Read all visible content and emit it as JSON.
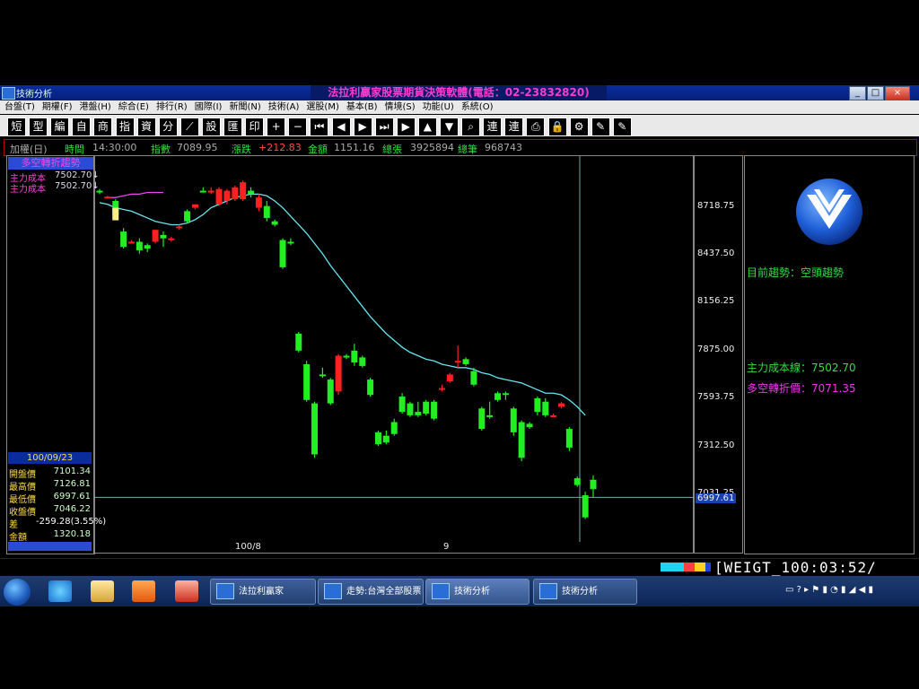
{
  "window": {
    "title": "技術分析",
    "app_title": "法拉利贏家股票期貨決策軟體(電話：02-23832820)",
    "controls": [
      "_",
      "□",
      "×"
    ]
  },
  "menu": [
    "台盤(T)",
    "期權(F)",
    "港盤(H)",
    "綜合(E)",
    "排行(R)",
    "國際(I)",
    "新聞(N)",
    "技術(A)",
    "選股(M)",
    "基本(B)",
    "情境(S)",
    "功能(U)",
    "系統(O)"
  ],
  "toolbar": [
    "短",
    "型",
    "編",
    "自",
    "商",
    "指",
    "資",
    "分",
    "⟋",
    "設",
    "匯",
    "印",
    "+",
    "−",
    "⏮",
    "◀",
    "▶",
    "⏭",
    "▶",
    "▲",
    "▼",
    "⌕",
    "連",
    "連",
    "⎙",
    "🔒",
    "⚙",
    "✎",
    "✎"
  ],
  "infobar": {
    "symbol": "加權(日)",
    "time_label": "時間",
    "time_value": "14:30:00",
    "index_label": "指數",
    "index_value": "7089.95",
    "change_label": "漲跌",
    "change_value": "+212.83",
    "amount_label": "金額",
    "amount_value": "1151.16",
    "vol_label": "總張",
    "vol_value": "3925894",
    "trades_label": "總筆",
    "trades_value": "968743"
  },
  "indicator": {
    "title": "多空轉折趨勢",
    "line1": "主力成本",
    "line1_value": "7502.70↓",
    "line2": "主力成本",
    "line2_value": "7502.70↓"
  },
  "ohlc": {
    "date": "100/09/23",
    "rows": [
      {
        "label": "開盤價",
        "value": "7101.34"
      },
      {
        "label": "最高價",
        "value": "7126.81"
      },
      {
        "label": "最低價",
        "value": "6997.61"
      },
      {
        "label": "收盤價",
        "value": "7046.22"
      },
      {
        "label": "差",
        "value": "-259.28(3.55%)"
      },
      {
        "label": "金額",
        "value": "1320.18"
      }
    ]
  },
  "chart_data": {
    "type": "candlestick",
    "ylim": [
      6900,
      9000
    ],
    "y_ticks": [
      "8718.75",
      "8437.50",
      "8156.25",
      "7875.00",
      "7593.75",
      "7312.50",
      "7031.25"
    ],
    "x_ticks": [
      "100/8",
      "9"
    ],
    "current_price_tag": "6997.61",
    "up_color": "#ff2020",
    "down_color": "#22ee22",
    "candles": [
      {
        "o": 8800,
        "h": 8810,
        "l": 8780,
        "c": 8790
      },
      {
        "o": 8760,
        "h": 8770,
        "l": 8760,
        "c": 8765
      },
      {
        "o": 8740,
        "h": 8750,
        "l": 8640,
        "c": 8660
      },
      {
        "o": 8560,
        "h": 8580,
        "l": 8460,
        "c": 8470
      },
      {
        "o": 8500,
        "h": 8510,
        "l": 8490,
        "c": 8500
      },
      {
        "o": 8500,
        "h": 8520,
        "l": 8430,
        "c": 8450
      },
      {
        "o": 8480,
        "h": 8490,
        "l": 8440,
        "c": 8460
      },
      {
        "o": 8500,
        "h": 8570,
        "l": 8490,
        "c": 8570
      },
      {
        "o": 8540,
        "h": 8560,
        "l": 8470,
        "c": 8520
      },
      {
        "o": 8520,
        "h": 8530,
        "l": 8500,
        "c": 8520
      },
      {
        "o": 8580,
        "h": 8600,
        "l": 8570,
        "c": 8590
      },
      {
        "o": 8680,
        "h": 8690,
        "l": 8610,
        "c": 8620
      },
      {
        "o": 8700,
        "h": 8720,
        "l": 8690,
        "c": 8720
      },
      {
        "o": 8800,
        "h": 8820,
        "l": 8790,
        "c": 8790
      },
      {
        "o": 8790,
        "h": 8820,
        "l": 8780,
        "c": 8800
      },
      {
        "o": 8720,
        "h": 8820,
        "l": 8710,
        "c": 8810
      },
      {
        "o": 8740,
        "h": 8810,
        "l": 8720,
        "c": 8800
      },
      {
        "o": 8750,
        "h": 8830,
        "l": 8740,
        "c": 8820
      },
      {
        "o": 8750,
        "h": 8860,
        "l": 8740,
        "c": 8850
      },
      {
        "o": 8800,
        "h": 8820,
        "l": 8760,
        "c": 8780
      },
      {
        "o": 8700,
        "h": 8780,
        "l": 8680,
        "c": 8760
      },
      {
        "o": 8710,
        "h": 8740,
        "l": 8620,
        "c": 8640
      },
      {
        "o": 8620,
        "h": 8630,
        "l": 8590,
        "c": 8600
      },
      {
        "o": 8510,
        "h": 8520,
        "l": 8340,
        "c": 8350
      },
      {
        "o": 8500,
        "h": 8520,
        "l": 8480,
        "c": 8490
      },
      {
        "o": 7960,
        "h": 7970,
        "l": 7850,
        "c": 7860
      },
      {
        "o": 7780,
        "h": 7800,
        "l": 7560,
        "c": 7570
      },
      {
        "o": 7550,
        "h": 7560,
        "l": 7230,
        "c": 7250
      },
      {
        "o": 7720,
        "h": 7760,
        "l": 7700,
        "c": 7710
      },
      {
        "o": 7690,
        "h": 7700,
        "l": 7540,
        "c": 7550
      },
      {
        "o": 7620,
        "h": 7840,
        "l": 7600,
        "c": 7830
      },
      {
        "o": 7830,
        "h": 7840,
        "l": 7810,
        "c": 7820
      },
      {
        "o": 7860,
        "h": 7900,
        "l": 7770,
        "c": 7790
      },
      {
        "o": 7820,
        "h": 7830,
        "l": 7760,
        "c": 7770
      },
      {
        "o": 7690,
        "h": 7700,
        "l": 7590,
        "c": 7600
      },
      {
        "o": 7380,
        "h": 7390,
        "l": 7300,
        "c": 7310
      },
      {
        "o": 7360,
        "h": 7390,
        "l": 7310,
        "c": 7320
      },
      {
        "o": 7440,
        "h": 7460,
        "l": 7360,
        "c": 7370
      },
      {
        "o": 7590,
        "h": 7610,
        "l": 7490,
        "c": 7500
      },
      {
        "o": 7550,
        "h": 7560,
        "l": 7470,
        "c": 7480
      },
      {
        "o": 7500,
        "h": 7560,
        "l": 7470,
        "c": 7480
      },
      {
        "o": 7560,
        "h": 7570,
        "l": 7480,
        "c": 7490
      },
      {
        "o": 7560,
        "h": 7570,
        "l": 7450,
        "c": 7460
      },
      {
        "o": 7640,
        "h": 7660,
        "l": 7620,
        "c": 7640
      },
      {
        "o": 7680,
        "h": 7730,
        "l": 7670,
        "c": 7720
      },
      {
        "o": 7790,
        "h": 7890,
        "l": 7760,
        "c": 7800
      },
      {
        "o": 7810,
        "h": 7820,
        "l": 7770,
        "c": 7780
      },
      {
        "o": 7740,
        "h": 7760,
        "l": 7650,
        "c": 7660
      },
      {
        "o": 7520,
        "h": 7530,
        "l": 7390,
        "c": 7400
      },
      {
        "o": 7480,
        "h": 7560,
        "l": 7460,
        "c": 7470
      },
      {
        "o": 7610,
        "h": 7620,
        "l": 7560,
        "c": 7570
      },
      {
        "o": 7610,
        "h": 7620,
        "l": 7570,
        "c": 7600
      },
      {
        "o": 7520,
        "h": 7530,
        "l": 7360,
        "c": 7380
      },
      {
        "o": 7440,
        "h": 7450,
        "l": 7210,
        "c": 7230
      },
      {
        "o": 7430,
        "h": 7440,
        "l": 7400,
        "c": 7410
      },
      {
        "o": 7580,
        "h": 7590,
        "l": 7480,
        "c": 7500
      },
      {
        "o": 7560,
        "h": 7580,
        "l": 7470,
        "c": 7480
      },
      {
        "o": 7480,
        "h": 7490,
        "l": 7470,
        "c": 7480
      },
      {
        "o": 7530,
        "h": 7560,
        "l": 7520,
        "c": 7550
      },
      {
        "o": 7400,
        "h": 7410,
        "l": 7270,
        "c": 7290
      },
      {
        "o": 7110,
        "h": 7120,
        "l": 7060,
        "c": 7070
      },
      {
        "o": 7010,
        "h": 7030,
        "l": 6870,
        "c": 6880
      },
      {
        "o": 7101,
        "h": 7127,
        "l": 6998,
        "c": 7046
      }
    ],
    "ma_cyan": [
      8730,
      8720,
      8700,
      8690,
      8680,
      8660,
      8640,
      8620,
      8610,
      8600,
      8600,
      8610,
      8630,
      8660,
      8700,
      8720,
      8740,
      8760,
      8770,
      8780,
      8780,
      8770,
      8740,
      8700,
      8650,
      8600,
      8550,
      8490,
      8430,
      8360,
      8300,
      8240,
      8180,
      8120,
      8060,
      8010,
      7960,
      7920,
      7880,
      7850,
      7830,
      7810,
      7800,
      7780,
      7770,
      7760,
      7760,
      7750,
      7730,
      7720,
      7700,
      7690,
      7680,
      7670,
      7650,
      7630,
      7610,
      7610,
      7600,
      7570,
      7530,
      7480
    ],
    "ma_magenta_x": [
      13,
      14,
      15,
      16,
      17,
      18,
      19,
      20
    ],
    "ma_magenta": [
      8760,
      8760,
      8770,
      8780,
      8780,
      8790,
      8790,
      8790
    ]
  },
  "right_panel": {
    "trend_label": "目前趨勢：",
    "trend_value": "空頭趨勢",
    "cost_line": "主力成本線：7502.70",
    "turn_price": "多空轉折價：7071.35"
  },
  "status": {
    "clock": "[WEIGT_100:03:52/"
  },
  "taskbar": {
    "tasks": [
      "法拉利贏家",
      "走勢:台灣全部股票",
      "技術分析",
      "技術分析"
    ],
    "tray": "▭ ? ▸ ⚑ ▮ ◔ ▮ ◢ ◀ ▮"
  }
}
